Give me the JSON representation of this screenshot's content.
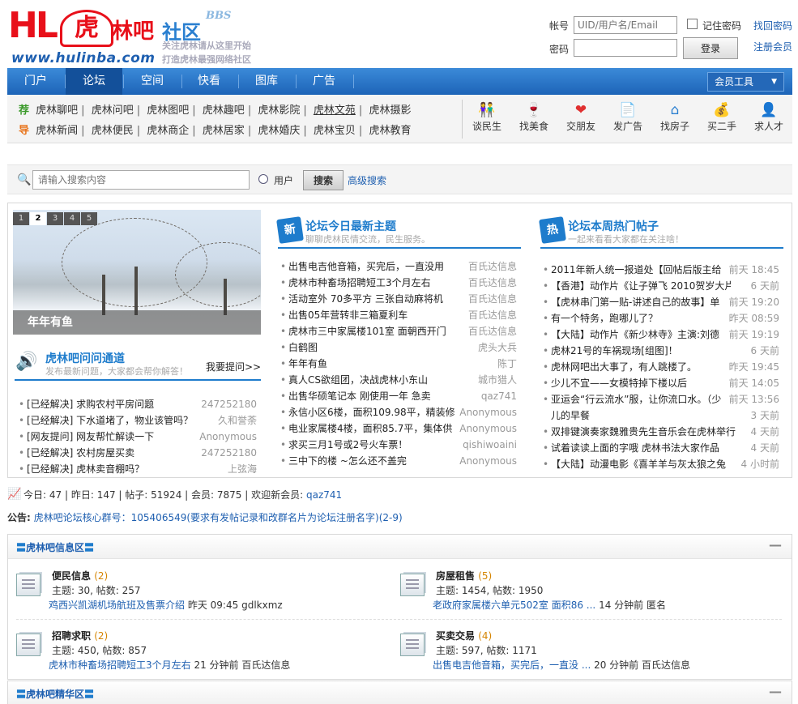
{
  "logo": {
    "brand_latin": "HL",
    "brand_cn": "林吧",
    "community": "社区",
    "bbs": "BBS",
    "url": "www.hulinba.com",
    "slogan1": "关注虎林请从这里开始",
    "slogan2": "打造虎林最强网络社区"
  },
  "login": {
    "account_label": "帐号",
    "account_placeholder": "UID/用户名/Email",
    "password_label": "密码",
    "remember_label": "记住密码",
    "login_button": "登录",
    "find_password": "找回密码",
    "register": "注册会员"
  },
  "nav": {
    "items": [
      "门户",
      "论坛",
      "空间",
      "快看",
      "图库",
      "广告"
    ],
    "active": "论坛",
    "tools": "会员工具"
  },
  "quick": {
    "row1_tag": "荐",
    "row1": [
      "虎林聊吧",
      "虎林问吧",
      "虎林图吧",
      "虎林趣吧",
      "虎林影院",
      "虎林文苑",
      "虎林摄影"
    ],
    "row2_tag": "导",
    "row2": [
      "虎林新闻",
      "虎林便民",
      "虎林商企",
      "虎林居家",
      "虎林婚庆",
      "虎林宝贝",
      "虎林教育"
    ],
    "icons": [
      {
        "label": "谈民生",
        "icon": "people-icon",
        "glyph": "👫"
      },
      {
        "label": "找美食",
        "icon": "wine-icon",
        "glyph": "🍷"
      },
      {
        "label": "交朋友",
        "icon": "heart-icon",
        "glyph": "❤"
      },
      {
        "label": "发广告",
        "icon": "ad-icon",
        "glyph": "📄"
      },
      {
        "label": "找房子",
        "icon": "house-icon",
        "glyph": "⌂"
      },
      {
        "label": "买二手",
        "icon": "money-bag-icon",
        "glyph": "💰"
      },
      {
        "label": "求人才",
        "icon": "person-icon",
        "glyph": "👤"
      }
    ]
  },
  "search": {
    "placeholder": "请输入搜索内容",
    "user_option": "用户",
    "button": "搜索",
    "advanced": "高级搜索"
  },
  "slideshow": {
    "pages": [
      "1",
      "2",
      "3",
      "4",
      "5"
    ],
    "current": "2",
    "caption": "年年有鱼"
  },
  "ask": {
    "badge": "",
    "title": "虎林吧问问通道",
    "subtitle": "发布最新问题，大家都会帮你解答！",
    "ask_link": "我要提问>>",
    "items": [
      {
        "title": "[已经解决] 求购农村平房问题",
        "author": "247252180"
      },
      {
        "title": "[已经解决] 下水道堵了，物业该管吗？",
        "author": "久和誉荼"
      },
      {
        "title": "[网友提问] 网友帮忙解读一下",
        "author": "Anonymous"
      },
      {
        "title": "[已经解决] 农村房屋买卖",
        "author": "247252180"
      },
      {
        "title": "[已经解决] 虎林卖音棚吗？",
        "author": "上弦海"
      }
    ]
  },
  "latest": {
    "badge": "新",
    "title": "论坛今日最新主题",
    "subtitle": "聊聊虎林民情交流，民生服务。",
    "items": [
      {
        "title": "出售电吉他音箱，买完后，一直没用",
        "author": "百氏达信息"
      },
      {
        "title": "虎林市种畜场招聘短工3个月左右",
        "author": "百氏达信息"
      },
      {
        "title": "活动室外 70多平方 三张自动麻将机",
        "author": "百氏达信息"
      },
      {
        "title": "出售05年营转非三箱夏利车",
        "author": "百氏达信息"
      },
      {
        "title": "虎林市三中家属楼101室 面朝西开门",
        "author": "百氏达信息"
      },
      {
        "title": "白鹤图",
        "author": "虎头大兵"
      },
      {
        "title": "年年有鱼",
        "author": "陈丁"
      },
      {
        "title": "真人CS欲组团，决战虎林小东山",
        "author": "城市猎人"
      },
      {
        "title": "出售华硕笔记本 刚使用一年 急卖",
        "author": "qaz741"
      },
      {
        "title": "永信小区6楼，面积109.98平，精装修",
        "author": "Anonymous"
      },
      {
        "title": "电业家属楼4楼，面积85.7平，集体供",
        "author": "Anonymous"
      },
      {
        "title": "求买三月1号或2号火车票！",
        "author": "qishiwoaini"
      },
      {
        "title": "三中下的楼 ~怎么还不盖完",
        "author": "Anonymous"
      }
    ]
  },
  "hot": {
    "badge": "热",
    "title": "论坛本周热门帖子",
    "subtitle": "一起来看看大家都在关注啥！",
    "items": [
      {
        "title": "2011年新人统一报道处【回帖后版主给",
        "time": "前天 18:45"
      },
      {
        "title": "【香港】动作片《让子弹飞 2010贺岁大片》",
        "time": "6 天前"
      },
      {
        "title": "【虎林串门第一贴-讲述自己的故事】单",
        "time": "前天 19:20"
      },
      {
        "title": "有一个特务，跑哪儿了？",
        "time": "昨天 08:59"
      },
      {
        "title": "【大陆】动作片《新少林寺》主演:刘德",
        "time": "前天 19:19"
      },
      {
        "title": "虎林21号的车祸现场[组图]！",
        "time": "6 天前"
      },
      {
        "title": "虎林网吧出大事了，有人跳楼了。",
        "time": "昨天 19:45"
      },
      {
        "title": "少儿不宜——女模特掉下楼以后",
        "time": "前天 14:05"
      },
      {
        "title": "亚运会“行云流水”服，让你流口水。（少",
        "time": "前天 13:56"
      },
      {
        "title": "儿的早餐",
        "time": "3 天前"
      },
      {
        "title": "双排键演奏家魏雅贵先生音乐会在虎林举行",
        "time": "4 天前"
      },
      {
        "title": "试着读读上面的字哦  虎林书法大家作品",
        "time": "4 天前"
      },
      {
        "title": "【大陆】动漫电影《喜羊羊与灰太狼之兔",
        "time": "4 小时前"
      }
    ]
  },
  "stats": {
    "today_label": "今日:",
    "today": "47",
    "yesterday_label": "昨日:",
    "yesterday": "147",
    "posts_label": "帖子:",
    "posts": "51924",
    "members_label": "会员:",
    "members": "7875",
    "welcome_label": "欢迎新会员:",
    "newest": "qaz741"
  },
  "notice": {
    "label": "公告:",
    "text": "虎林吧论坛核心群号：105406549(要求有发帖记录和改群名片为论坛注册名字)(2-9)"
  },
  "section1": {
    "title": "虎林吧信息区",
    "forums": [
      {
        "name": "便民信息",
        "new": "(2)",
        "stats": "主题: 30, 帖数: 257",
        "last_post": "鸡西兴凯湖机场航班及售票介绍",
        "last_time": "昨天 09:45",
        "last_user": "gdlkxmz"
      },
      {
        "name": "房屋租售",
        "new": "(5)",
        "stats": "主题: 1454, 帖数: 1950",
        "last_post": "老政府家属楼六单元502室 面积86 ...",
        "last_time": "14 分钟前",
        "last_user": "匿名"
      },
      {
        "name": "招聘求职",
        "new": "(2)",
        "stats": "主题: 450, 帖数: 857",
        "last_post": "虎林市种畜场招聘短工3个月左右",
        "last_time": "21 分钟前",
        "last_user": "百氏达信息"
      },
      {
        "name": "买卖交易",
        "new": "(4)",
        "stats": "主题: 597, 帖数: 1171",
        "last_post": "出售电吉他音箱，买完后，一直没 ...",
        "last_time": "20 分钟前",
        "last_user": "百氏达信息"
      }
    ]
  },
  "section2": {
    "title": "虎林吧精华区"
  },
  "colors": {
    "brand_red": "#e8101a",
    "nav_blue": "#1d64b8",
    "link_blue": "#1e5fb0",
    "accent_orange": "#d58400"
  }
}
